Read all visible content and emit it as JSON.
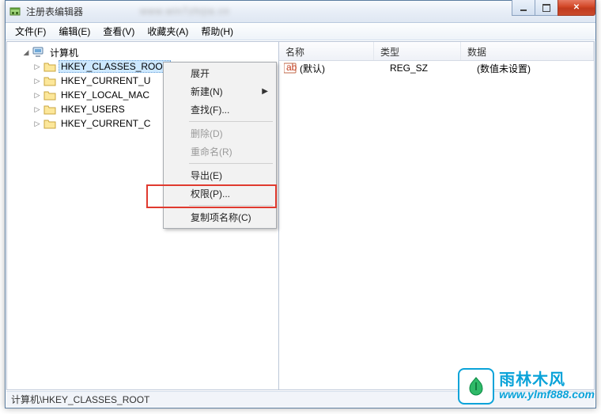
{
  "window": {
    "title": "注册表编辑器",
    "blurred_url": "www.win7zhijia.cn"
  },
  "menubar": {
    "file": "文件(F)",
    "edit": "编辑(E)",
    "view": "查看(V)",
    "favorites": "收藏夹(A)",
    "help": "帮助(H)"
  },
  "tree": {
    "root": "计算机",
    "items": [
      "HKEY_CLASSES_ROOT",
      "HKEY_CURRENT_USER",
      "HKEY_LOCAL_MACHINE",
      "HKEY_USERS",
      "HKEY_CURRENT_CONFIG"
    ],
    "items_visible": [
      "HKEY_CLASSES_ROOT",
      "HKEY_CURRENT_U",
      "HKEY_LOCAL_MAC",
      "HKEY_USERS",
      "HKEY_CURRENT_C"
    ],
    "selected_index": 0
  },
  "list": {
    "columns": {
      "name": "名称",
      "type": "类型",
      "data": "数据"
    },
    "rows": [
      {
        "icon": "ab",
        "name": "(默认)",
        "type": "REG_SZ",
        "data": "(数值未设置)"
      }
    ]
  },
  "context_menu": {
    "expand": "展开",
    "new": "新建(N)",
    "find": "查找(F)...",
    "delete": "删除(D)",
    "rename": "重命名(R)",
    "export": "导出(E)",
    "permissions": "权限(P)...",
    "copy_key_name": "复制项名称(C)"
  },
  "statusbar": {
    "path": "计算机\\HKEY_CLASSES_ROOT"
  },
  "watermark": {
    "cn": "雨林木风",
    "url": "www.ylmf888.com"
  }
}
